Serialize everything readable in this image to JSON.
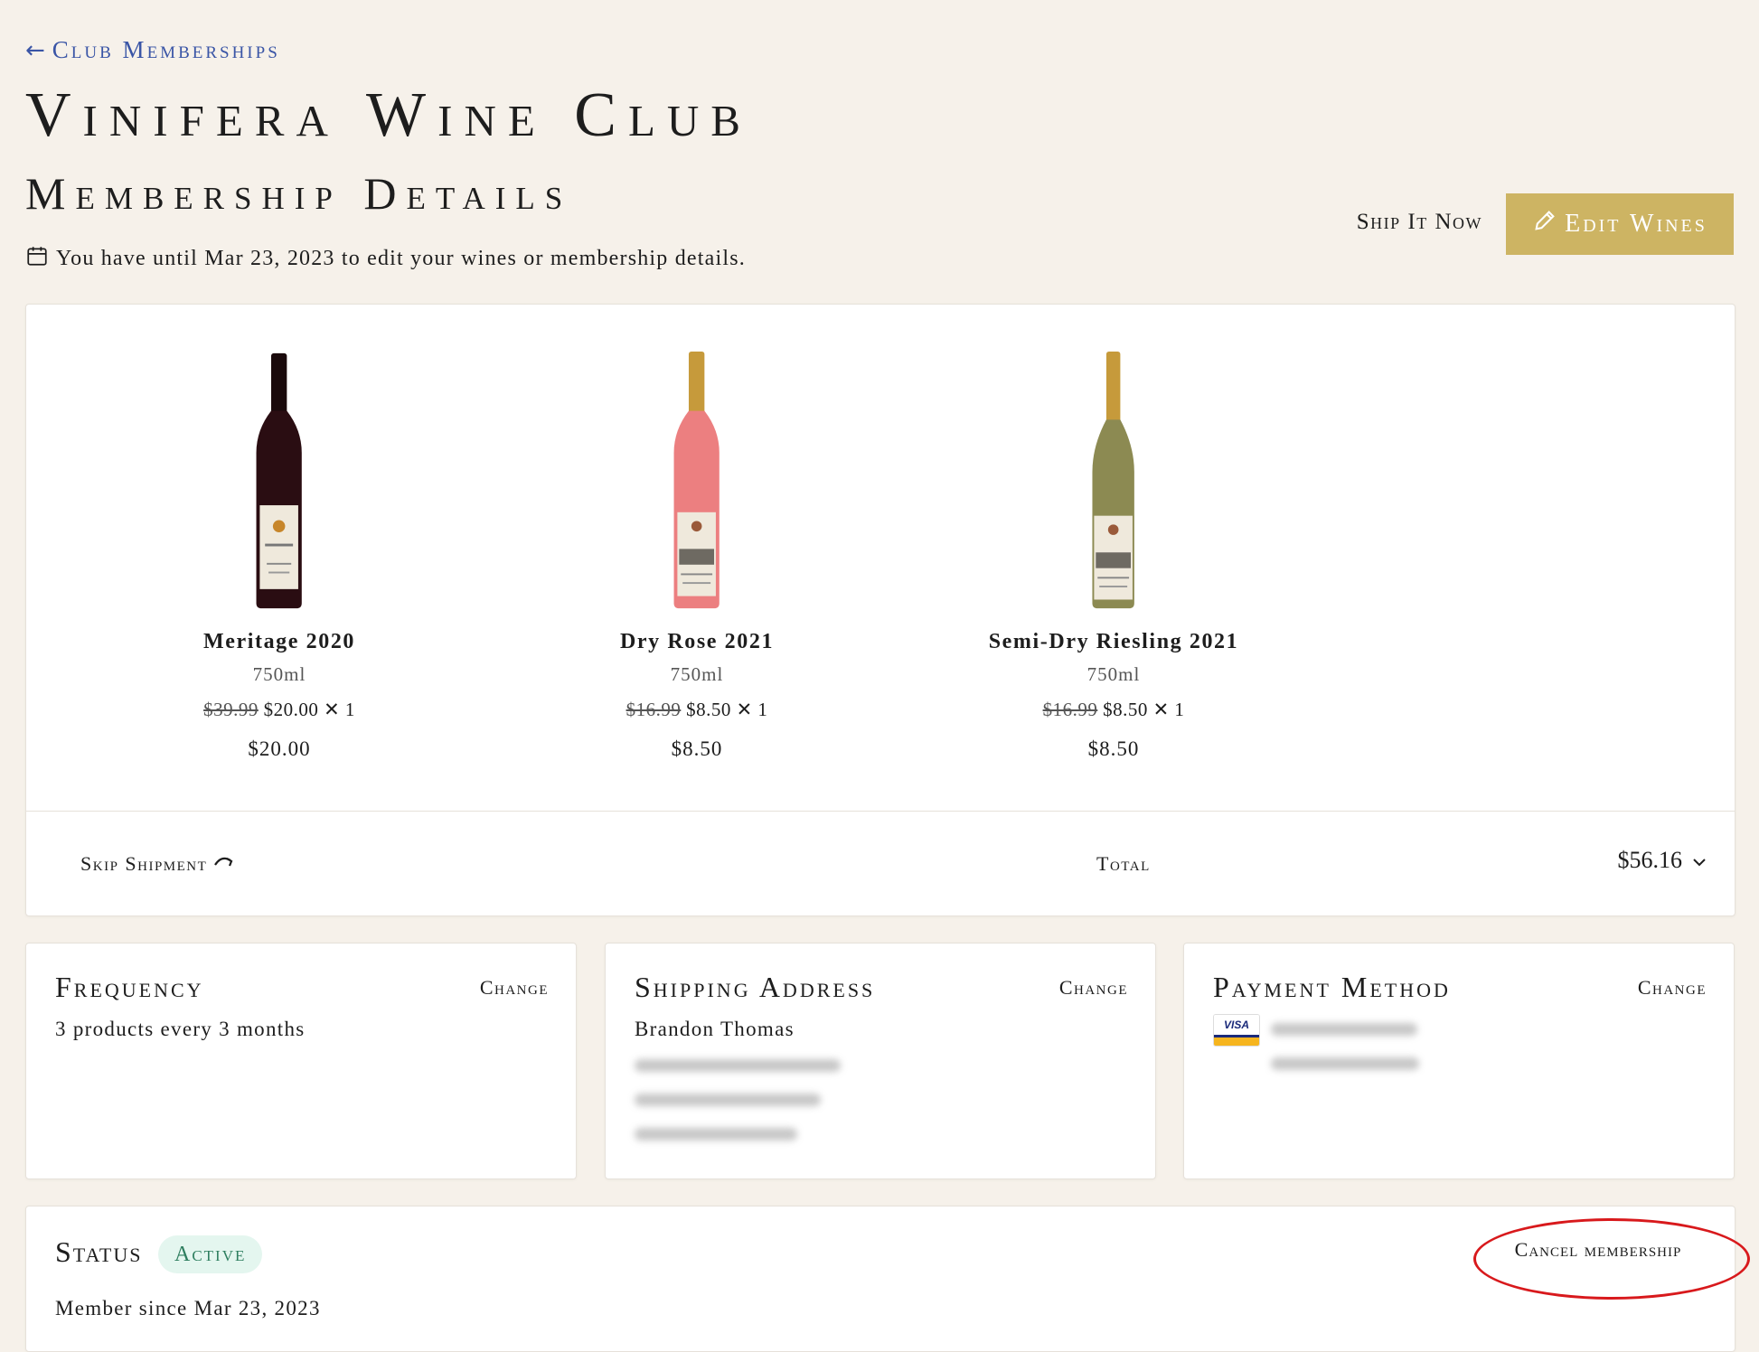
{
  "nav": {
    "back_label": "Club Memberships"
  },
  "header": {
    "club_title": "Vinifera Wine Club",
    "section_title": "Membership Details",
    "deadline_text": "You have until Mar 23, 2023 to edit your wines or membership details.",
    "ship_now_label": "Ship It Now",
    "edit_wines_label": "Edit Wines"
  },
  "wines": [
    {
      "name": "Meritage 2020",
      "size": "750ml",
      "original_price": "$39.99",
      "sale_price": "$20.00",
      "quantity": "✕ 1",
      "line_total": "$20.00",
      "bottle_color": "#2a0d12"
    },
    {
      "name": "Dry Rose 2021",
      "size": "750ml",
      "original_price": "$16.99",
      "sale_price": "$8.50",
      "quantity": "✕ 1",
      "line_total": "$8.50",
      "bottle_color": "#ec7f80"
    },
    {
      "name": "Semi-Dry Riesling 2021",
      "size": "750ml",
      "original_price": "$16.99",
      "sale_price": "$8.50",
      "quantity": "✕ 1",
      "line_total": "$8.50",
      "bottle_color": "#8c8a52"
    }
  ],
  "summary": {
    "skip_label": "Skip Shipment",
    "total_label": "Total",
    "total_value": "$56.16"
  },
  "frequency": {
    "heading": "Frequency",
    "change_label": "Change",
    "value": "3 products every 3 months"
  },
  "shipping": {
    "heading": "Shipping Address",
    "change_label": "Change",
    "name": "Brandon Thomas"
  },
  "payment": {
    "heading": "Payment Method",
    "change_label": "Change",
    "card_brand": "VISA"
  },
  "status": {
    "heading": "Status",
    "badge": "Active",
    "member_since": "Member since Mar 23, 2023",
    "cancel_label": "Cancel membership"
  },
  "colors": {
    "background": "#f6f1ea",
    "accent_gold": "#cdb463",
    "link_blue": "#3a55a6",
    "active_badge_bg": "#e4f6ef",
    "active_badge_text": "#2e7e5f",
    "annotation_red": "#d8191c"
  }
}
